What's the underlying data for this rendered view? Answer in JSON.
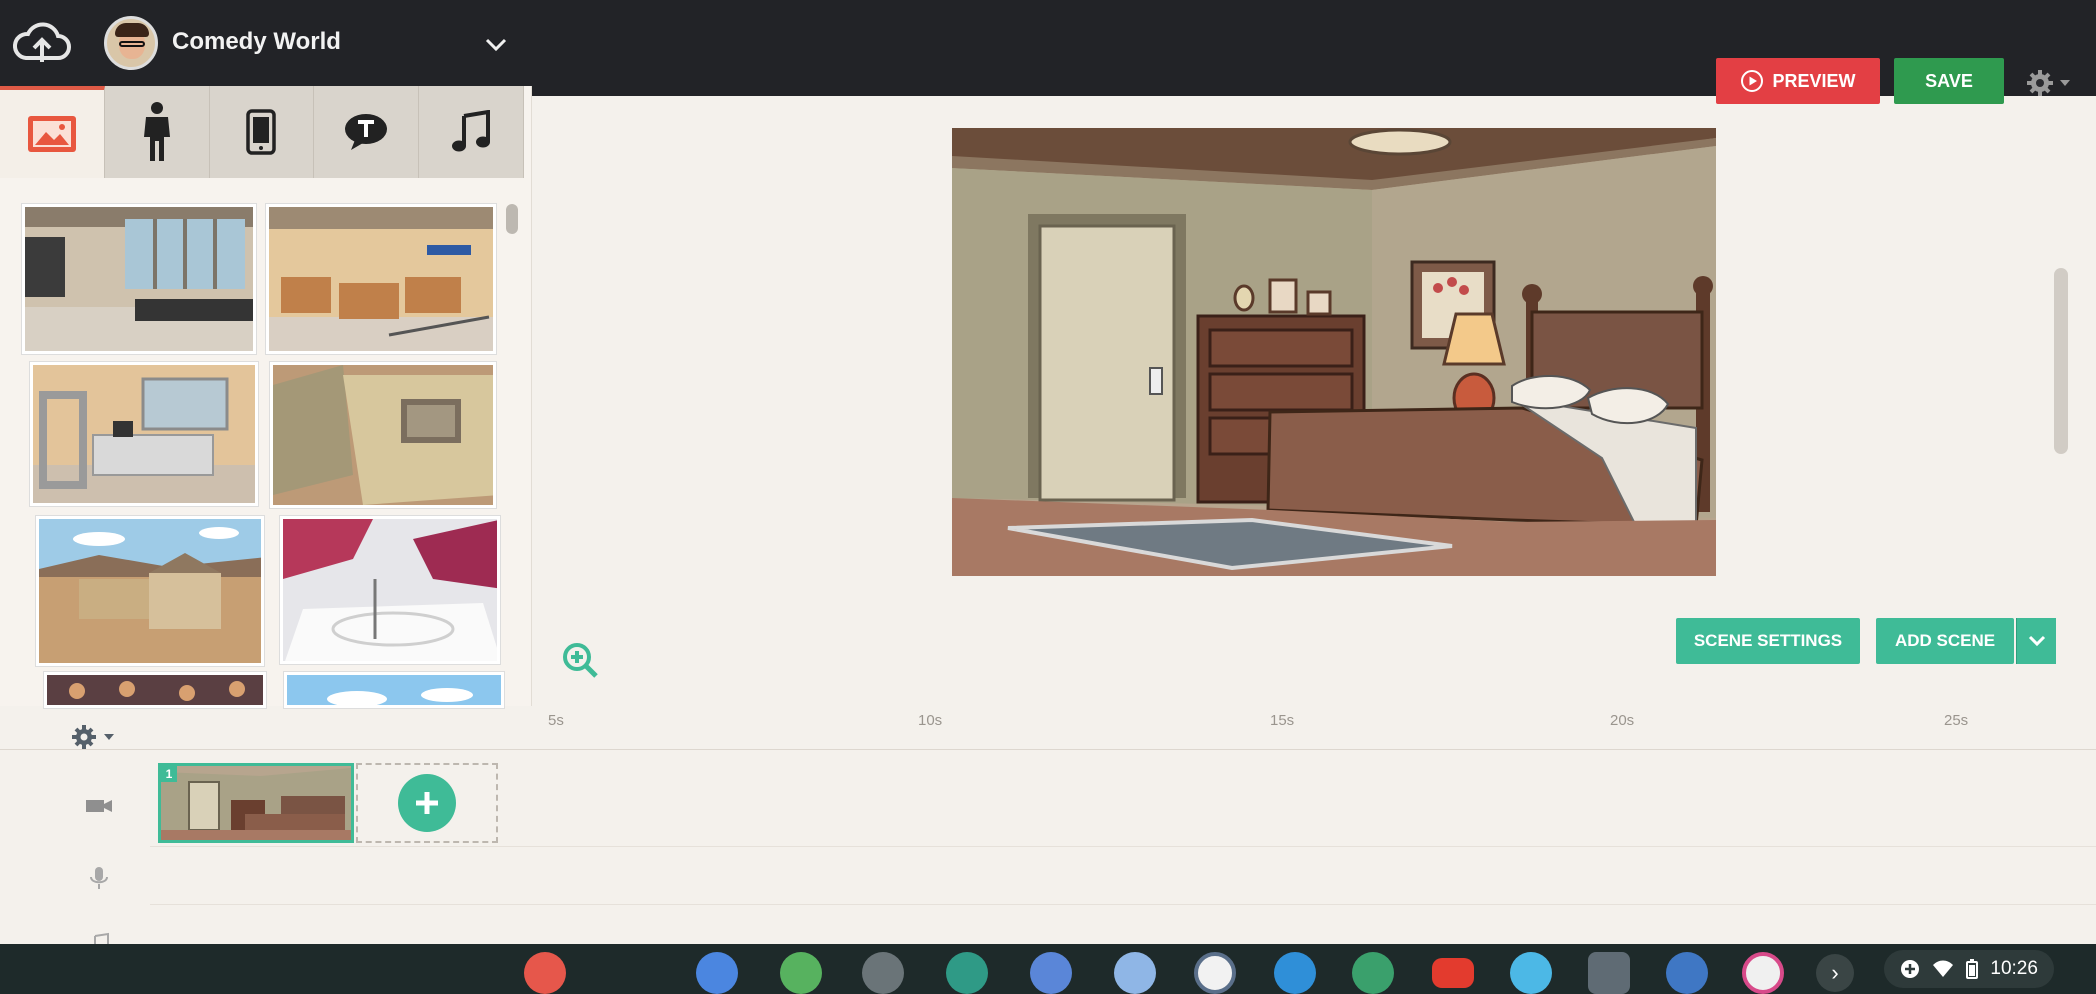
{
  "header": {
    "project_title": "Comedy World",
    "preview_label": "PREVIEW",
    "save_label": "SAVE"
  },
  "library": {
    "tabs": [
      "image-tab",
      "character-tab",
      "device-tab",
      "text-tab",
      "music-tab"
    ],
    "active_tab": "image-tab"
  },
  "stage": {
    "scene_settings_label": "SCENE SETTINGS",
    "add_scene_label": "ADD SCENE"
  },
  "timeline": {
    "ticks": [
      "5s",
      "10s",
      "15s",
      "20s",
      "25s"
    ],
    "scene_number": "1"
  },
  "shelf": {
    "time": "10:26"
  },
  "colors": {
    "accent_teal": "#3fbb97",
    "preview_red": "#e33f44",
    "save_green": "#2f9a4f",
    "topbar": "#222327"
  }
}
